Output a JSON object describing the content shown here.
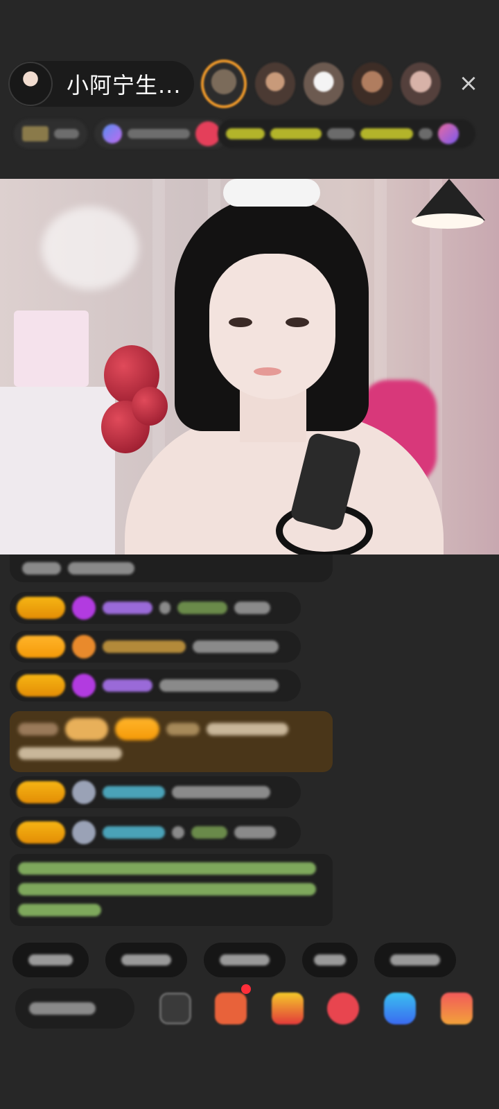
{
  "header": {
    "host_name": "小阿宁生...",
    "close_icon": "×"
  },
  "colors": {
    "background": "#272727",
    "pill": "#1b1b1b",
    "badge_gold": "#f6b514",
    "notice_bg": "#4a3619",
    "system_text": "#7ea85c",
    "viewer_ring": "#f09a2a"
  }
}
